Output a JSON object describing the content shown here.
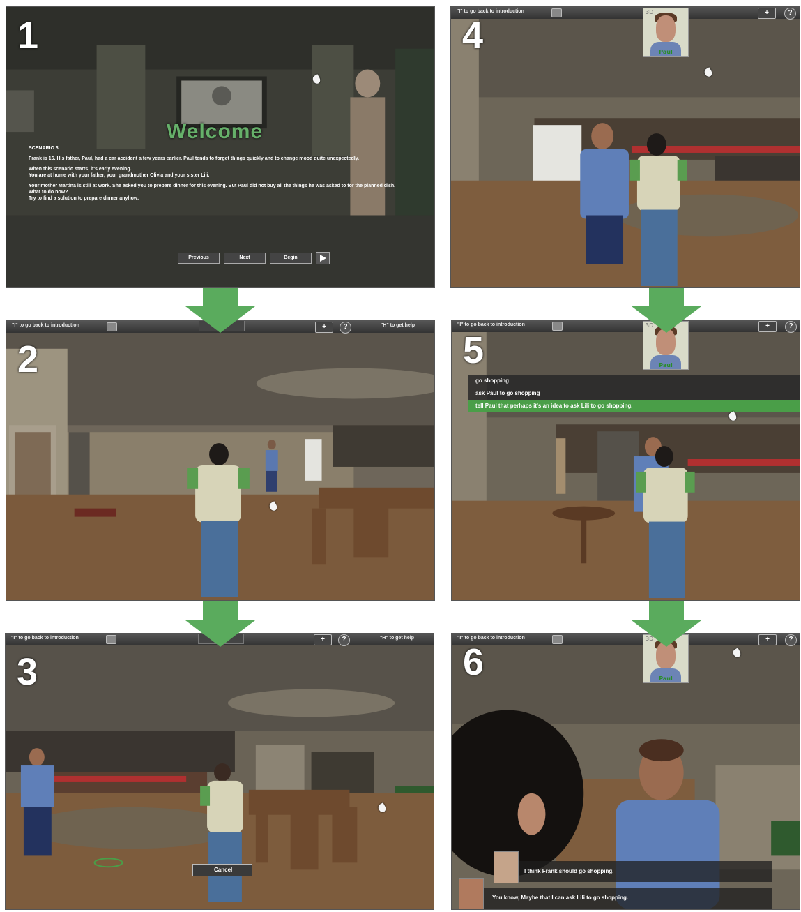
{
  "hud": {
    "intro_hint": "\"I\" to go back to introduction",
    "help_hint": "\"H\" to get help",
    "expand_label": "+",
    "question_label": "?"
  },
  "portrait": {
    "name": "Paul",
    "tag": "3D"
  },
  "panels": [
    {
      "number": "1"
    },
    {
      "number": "2"
    },
    {
      "number": "3"
    },
    {
      "number": "4"
    },
    {
      "number": "5"
    },
    {
      "number": "6"
    }
  ],
  "intro": {
    "welcome": "Welcome",
    "scenario": "SCENARIO 3",
    "para1": "Frank is 16. His father, Paul, had a car accident a few years earlier. Paul tends to forget things quickly and to change mood quite unexpectedly.",
    "para2a": "When this scenario starts, it's early evening.",
    "para2b": "You are at home with your father, your grandmother Olivia and your sister Lili.",
    "para3a": "Your mother Martina is still at work. She asked you to prepare dinner for this evening. But Paul did not buy all the things he was asked to for the planned dish.",
    "para3b": "What to do now?",
    "para3c": "Try to find a solution to prepare dinner anyhow.",
    "previous": "Previous",
    "next": "Next",
    "begin": "Begin"
  },
  "choices": [
    "go  shopping",
    "ask Paul to go  shopping",
    "tell Paul that perhaps it's an idea to ask Lili to go  shopping."
  ],
  "cancel_label": "Cancel",
  "dialog": {
    "line1": "I think Frank should go shopping.",
    "line2": "You know, Maybe that I can ask Lili to go  shopping."
  },
  "colors": {
    "arrow": "#5aab5d",
    "highlight": "#4a9e48",
    "welcome": "#66b06a"
  }
}
